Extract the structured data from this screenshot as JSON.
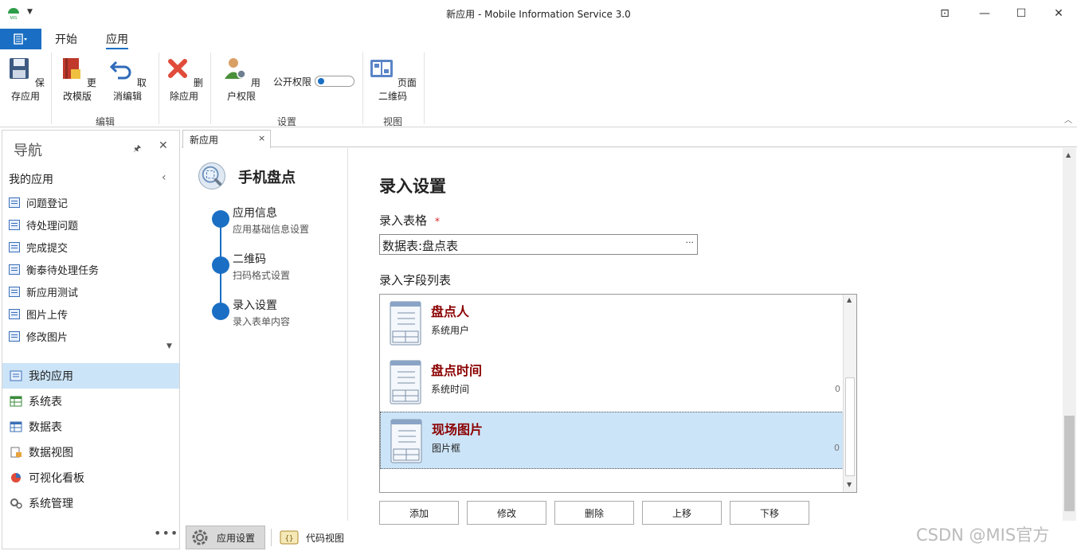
{
  "window": {
    "title": "新应用 - Mobile Information Service 3.0",
    "logo_text": "MIS"
  },
  "ribbon": {
    "tabs": [
      "开始",
      "应用"
    ],
    "active_tab": "应用",
    "buttons": {
      "save": "保存应用",
      "change_template": "更改模版",
      "cancel_edit": "取消编辑",
      "delete_app": "删除应用",
      "user_permission": "用户权限",
      "page_qrcode": "页面二维码"
    },
    "toggle": {
      "label": "公开权限",
      "on": false
    },
    "groups": {
      "edit": "编辑",
      "settings": "设置",
      "view": "视图"
    }
  },
  "nav": {
    "title": "导航",
    "section": "我的应用",
    "items": [
      "问题登记",
      "待处理问题",
      "完成提交",
      "衡泰待处理任务",
      "新应用测试",
      "图片上传",
      "修改图片"
    ],
    "categories": [
      "我的应用",
      "系统表",
      "数据表",
      "数据视图",
      "可视化看板",
      "系统管理"
    ],
    "selected_category": "我的应用",
    "more": "•••"
  },
  "doc_tab": {
    "label": "新应用",
    "close": "×"
  },
  "steps": {
    "app_name": "手机盘点",
    "list": [
      {
        "title": "应用信息",
        "sub": "应用基础信息设置"
      },
      {
        "title": "二维码",
        "sub": "扫码格式设置"
      },
      {
        "title": "录入设置",
        "sub": "录入表单内容"
      }
    ]
  },
  "main": {
    "heading": "录入设置",
    "table_label": "录入表格",
    "required_mark": "*",
    "table_value": "数据表:盘点表",
    "table_dots": "···",
    "fields_label": "录入字段列表",
    "fields": [
      {
        "name": "盘点人",
        "type": "系统用户",
        "num": ""
      },
      {
        "name": "盘点时间",
        "type": "系统时间",
        "num": "0"
      },
      {
        "name": "现场图片",
        "type": "图片框",
        "num": "0"
      }
    ],
    "selected_field": "现场图片",
    "actions": [
      "添加",
      "修改",
      "删除",
      "上移",
      "下移"
    ]
  },
  "bottom": {
    "tabs": [
      "应用设置",
      "代码视图"
    ],
    "active": "应用设置"
  },
  "watermark": "CSDN @MIS官方"
}
